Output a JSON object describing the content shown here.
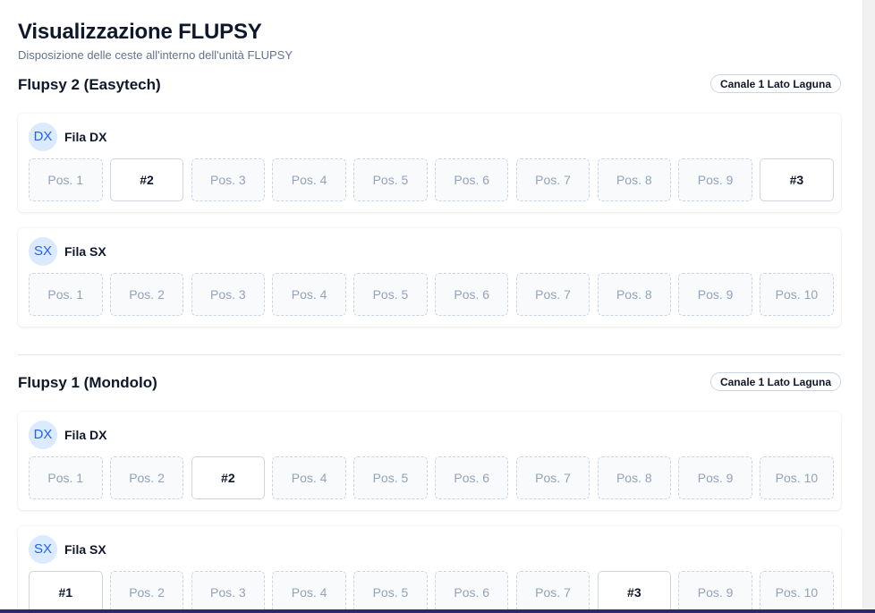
{
  "page": {
    "title": "Visualizzazione FLUPSY",
    "subtitle": "Disposizione delle ceste all'interno dell'unità FLUPSY"
  },
  "flupsys": [
    {
      "name": "Flupsy 2 (Easytech)",
      "channel": "Canale 1 Lato Laguna",
      "rows": [
        {
          "avatar": "DX",
          "label": "Fila DX",
          "slots": [
            {
              "text": "Pos. 1",
              "filled": false
            },
            {
              "text": "#2",
              "filled": true
            },
            {
              "text": "Pos. 3",
              "filled": false
            },
            {
              "text": "Pos. 4",
              "filled": false
            },
            {
              "text": "Pos. 5",
              "filled": false
            },
            {
              "text": "Pos. 6",
              "filled": false
            },
            {
              "text": "Pos. 7",
              "filled": false
            },
            {
              "text": "Pos. 8",
              "filled": false
            },
            {
              "text": "Pos. 9",
              "filled": false
            },
            {
              "text": "#3",
              "filled": true
            }
          ]
        },
        {
          "avatar": "SX",
          "label": "Fila SX",
          "slots": [
            {
              "text": "Pos. 1",
              "filled": false
            },
            {
              "text": "Pos. 2",
              "filled": false
            },
            {
              "text": "Pos. 3",
              "filled": false
            },
            {
              "text": "Pos. 4",
              "filled": false
            },
            {
              "text": "Pos. 5",
              "filled": false
            },
            {
              "text": "Pos. 6",
              "filled": false
            },
            {
              "text": "Pos. 7",
              "filled": false
            },
            {
              "text": "Pos. 8",
              "filled": false
            },
            {
              "text": "Pos. 9",
              "filled": false
            },
            {
              "text": "Pos. 10",
              "filled": false
            }
          ]
        }
      ]
    },
    {
      "name": "Flupsy 1 (Mondolo)",
      "channel": "Canale 1 Lato Laguna",
      "rows": [
        {
          "avatar": "DX",
          "label": "Fila DX",
          "slots": [
            {
              "text": "Pos. 1",
              "filled": false
            },
            {
              "text": "Pos. 2",
              "filled": false
            },
            {
              "text": "#2",
              "filled": true
            },
            {
              "text": "Pos. 4",
              "filled": false
            },
            {
              "text": "Pos. 5",
              "filled": false
            },
            {
              "text": "Pos. 6",
              "filled": false
            },
            {
              "text": "Pos. 7",
              "filled": false
            },
            {
              "text": "Pos. 8",
              "filled": false
            },
            {
              "text": "Pos. 9",
              "filled": false
            },
            {
              "text": "Pos. 10",
              "filled": false
            }
          ]
        },
        {
          "avatar": "SX",
          "label": "Fila SX",
          "slots": [
            {
              "text": "#1",
              "filled": true
            },
            {
              "text": "Pos. 2",
              "filled": false
            },
            {
              "text": "Pos. 3",
              "filled": false
            },
            {
              "text": "Pos. 4",
              "filled": false
            },
            {
              "text": "Pos. 5",
              "filled": false
            },
            {
              "text": "Pos. 6",
              "filled": false
            },
            {
              "text": "Pos. 7",
              "filled": false
            },
            {
              "text": "#3",
              "filled": true
            },
            {
              "text": "Pos. 9",
              "filled": false
            },
            {
              "text": "Pos. 10",
              "filled": false
            }
          ]
        }
      ]
    }
  ]
}
